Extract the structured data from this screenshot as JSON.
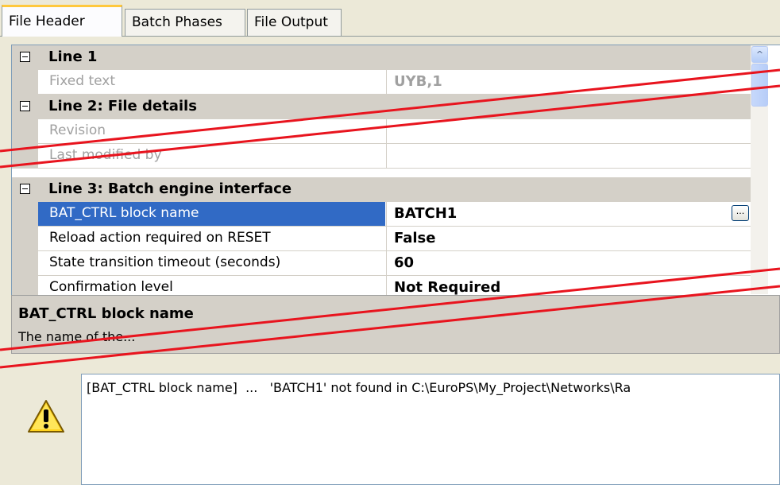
{
  "tabs": [
    {
      "label": "File Header",
      "active": true
    },
    {
      "label": "Batch Phases",
      "active": false
    },
    {
      "label": "File Output",
      "active": false
    }
  ],
  "grid": {
    "line1": {
      "category": "Line 1",
      "fixed_text_label": "Fixed text",
      "fixed_text_value": "UYB,1"
    },
    "line2": {
      "category": "Line 2:  File details",
      "revision_label": "Revision",
      "last_modified_label": "Last modified by"
    },
    "line3": {
      "category": "Line 3:  Batch engine interface",
      "rows": [
        {
          "label": "BAT_CTRL block name",
          "value": "BATCH1"
        },
        {
          "label": "Reload action required on RESET",
          "value": "False"
        },
        {
          "label": "State transition timeout (seconds)",
          "value": "60"
        },
        {
          "label": "Confirmation level",
          "value": "Not Required"
        }
      ],
      "ellipsis_label": "..."
    },
    "scroll_up_glyph": "^"
  },
  "description": {
    "title": "BAT_CTRL block name",
    "text": "The name of the..."
  },
  "messages": {
    "text": "[BAT_CTRL block name]  ...   'BATCH1' not found in C:\\EuroPS\\My_Project\\Networks\\Ra",
    "icon": "warning-icon"
  },
  "colors": {
    "selection": "#316ac5",
    "break_line": "#e8141e",
    "tab_highlight": "#ffc83c"
  }
}
